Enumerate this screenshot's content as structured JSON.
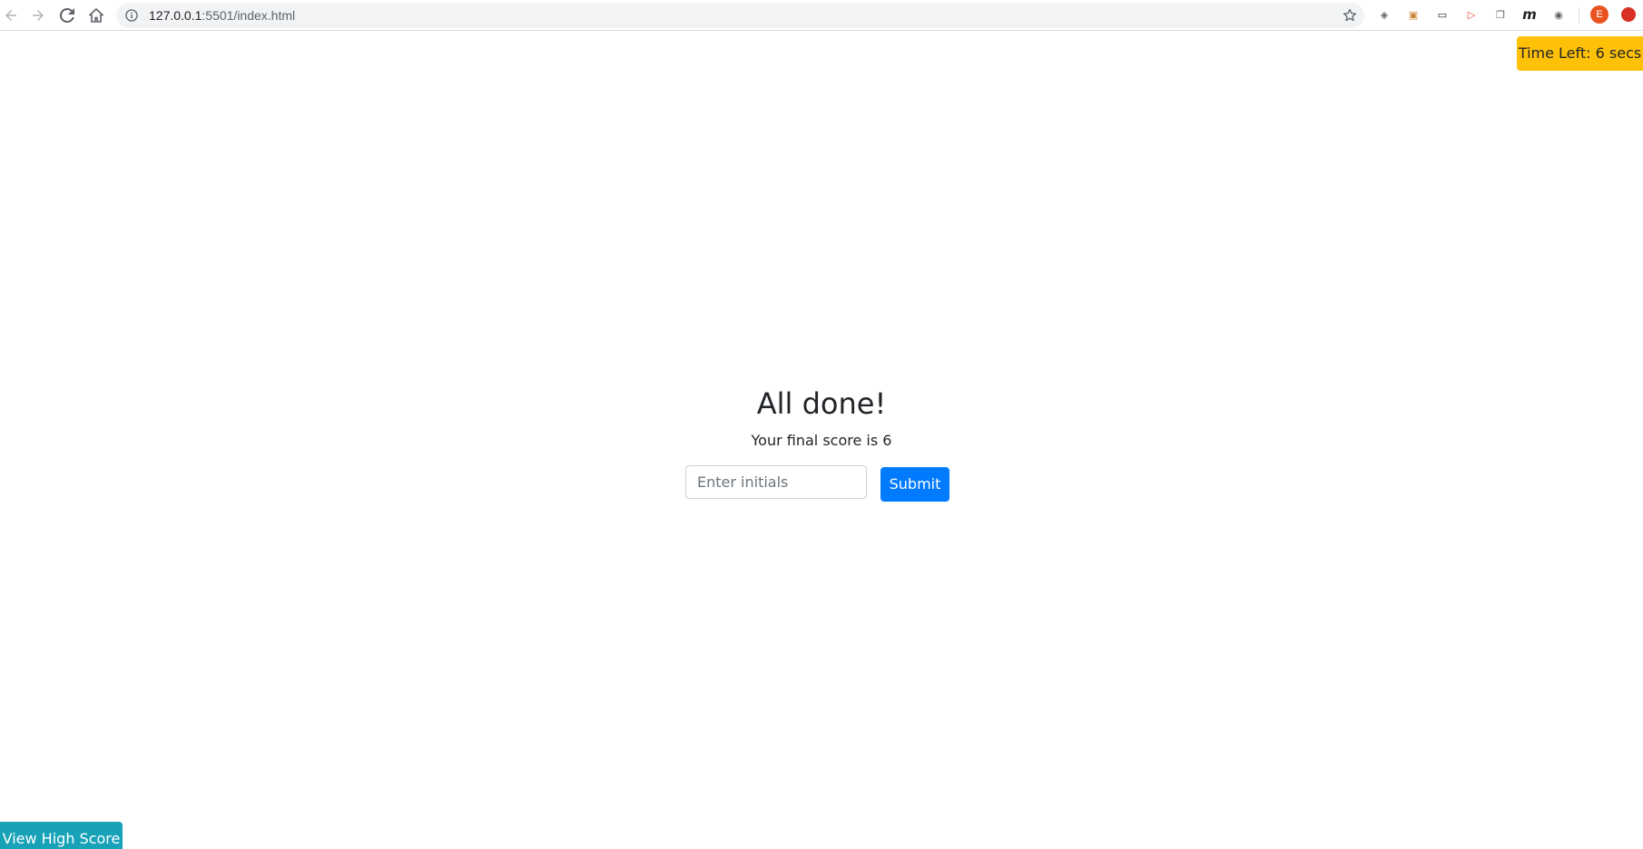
{
  "browser": {
    "url_host": "127.0.0.1",
    "url_rest": ":5501/index.html",
    "profile_initial": "E",
    "extensions": [
      {
        "name": "ublock-icon",
        "glyph": "◈",
        "color": "#5f6368"
      },
      {
        "name": "honey-icon",
        "glyph": "▣",
        "color": "#c9893b"
      },
      {
        "name": "picture-in-picture-icon",
        "glyph": "▭",
        "color": "#202124"
      },
      {
        "name": "screencast-icon",
        "glyph": "▷",
        "color": "#ea4335"
      },
      {
        "name": "copy-icon",
        "glyph": "❐",
        "color": "#5f6368"
      },
      {
        "name": "m-extension-icon",
        "glyph": "m",
        "color": "#202124"
      },
      {
        "name": "audio-icon",
        "glyph": "◉",
        "color": "#5f6368"
      }
    ]
  },
  "quiz": {
    "timer_label": "Time Left: 6 secs",
    "title": "All done!",
    "score_text": "Your final score is 6",
    "initials_placeholder": "Enter initials",
    "submit_label": "Submit",
    "high_score_label": "View High Score"
  },
  "colors": {
    "timer_bg": "#ffc107",
    "submit_bg": "#007bff",
    "high_score_bg": "#17a2b8"
  }
}
